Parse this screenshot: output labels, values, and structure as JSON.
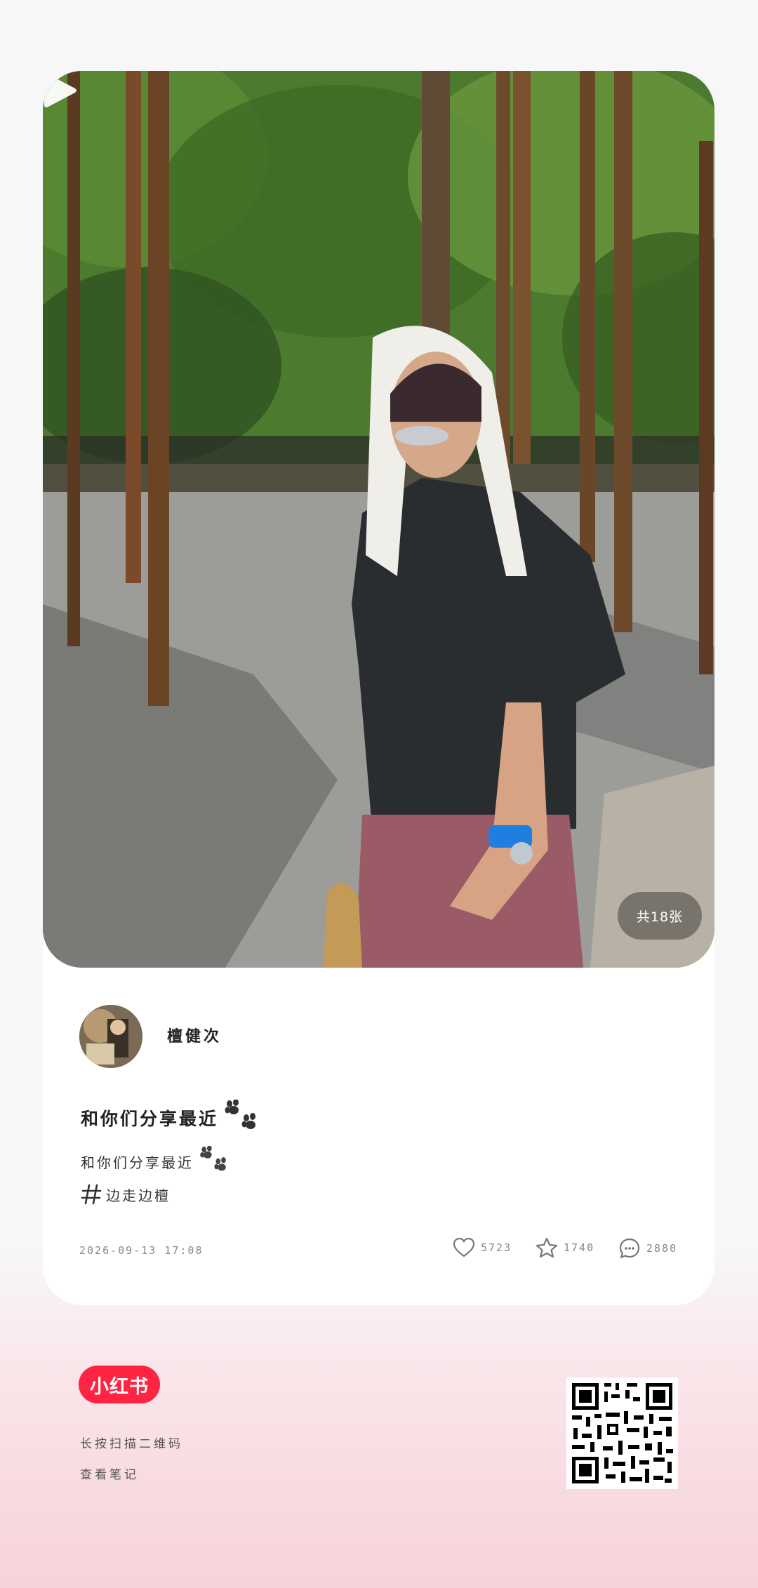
{
  "photo": {
    "count_label": "共18张",
    "play_icon": "play-icon"
  },
  "author": {
    "name": "檀健次"
  },
  "note": {
    "title": "和你们分享最近",
    "description": "和你们分享最近",
    "tag": "边走边檀",
    "date": "2026-09-13 17:08"
  },
  "stats": {
    "likes": "5723",
    "collects": "1740",
    "comments": "2880"
  },
  "footer": {
    "logo_text": "小红书",
    "hint_line1": "长按扫描二维码",
    "hint_line2": "查看笔记"
  },
  "colors": {
    "brand": "#ff2442",
    "background_bottom": "#f8d2da"
  }
}
